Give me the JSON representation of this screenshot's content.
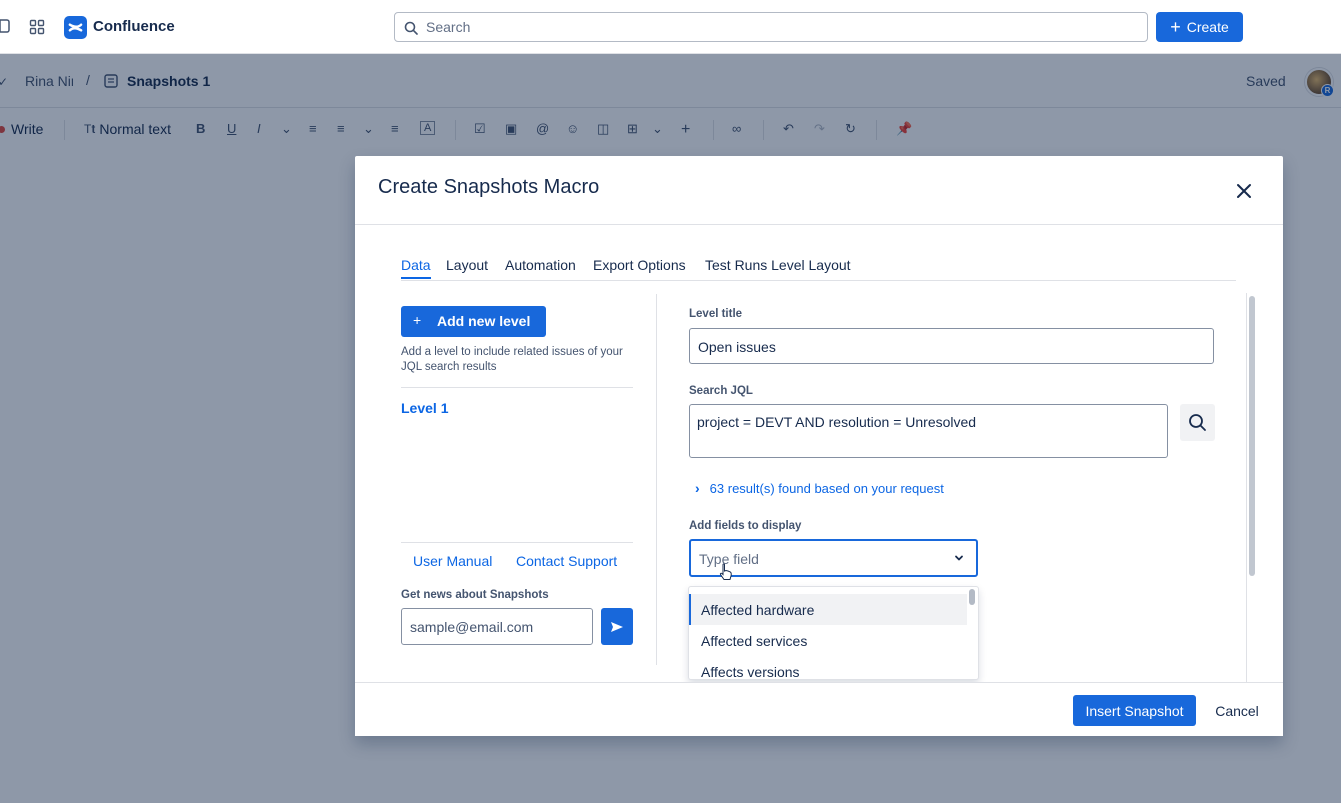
{
  "app": {
    "brand": "Confluence",
    "search_placeholder": "Search",
    "create_label": "Create"
  },
  "breadcrumb": {
    "user": "Rina Nir",
    "separator": "/",
    "page_title": "Snapshots 1",
    "status": "Saved",
    "avatar_badge": "R"
  },
  "toolbar": {
    "write_label": "Write",
    "text_style_label": "Normal text"
  },
  "modal": {
    "title": "Create Snapshots Macro",
    "tabs": [
      {
        "label": "Data",
        "active": true
      },
      {
        "label": "Layout",
        "active": false
      },
      {
        "label": "Automation",
        "active": false
      },
      {
        "label": "Export Options",
        "active": false
      },
      {
        "label": "Test Runs Level Layout",
        "active": false
      }
    ],
    "left": {
      "add_level_label": "Add new level",
      "add_level_help": "Add a level to include related issues of your JQL search results",
      "levels": [
        "Level 1"
      ],
      "user_manual": "User Manual",
      "contact_support": "Contact Support",
      "news_label": "Get news about Snapshots",
      "news_placeholder": "sample@email.com"
    },
    "right": {
      "level_title_label": "Level title",
      "level_title_value": "Open issues",
      "search_jql_label": "Search JQL",
      "search_jql_value": "project = DEVT AND resolution = Unresolved",
      "results_text": "63 result(s) found based on your request",
      "fields_label": "Add fields to display",
      "fields_placeholder": "Type field",
      "options": [
        "Affected hardware",
        "Affected services",
        "Affects versions"
      ]
    },
    "footer": {
      "insert_label": "Insert Snapshot",
      "cancel_label": "Cancel"
    }
  },
  "colors": {
    "accent": "#1868db",
    "link": "#0c66e4",
    "overlay": "rgba(9,30,66,0.46)"
  }
}
